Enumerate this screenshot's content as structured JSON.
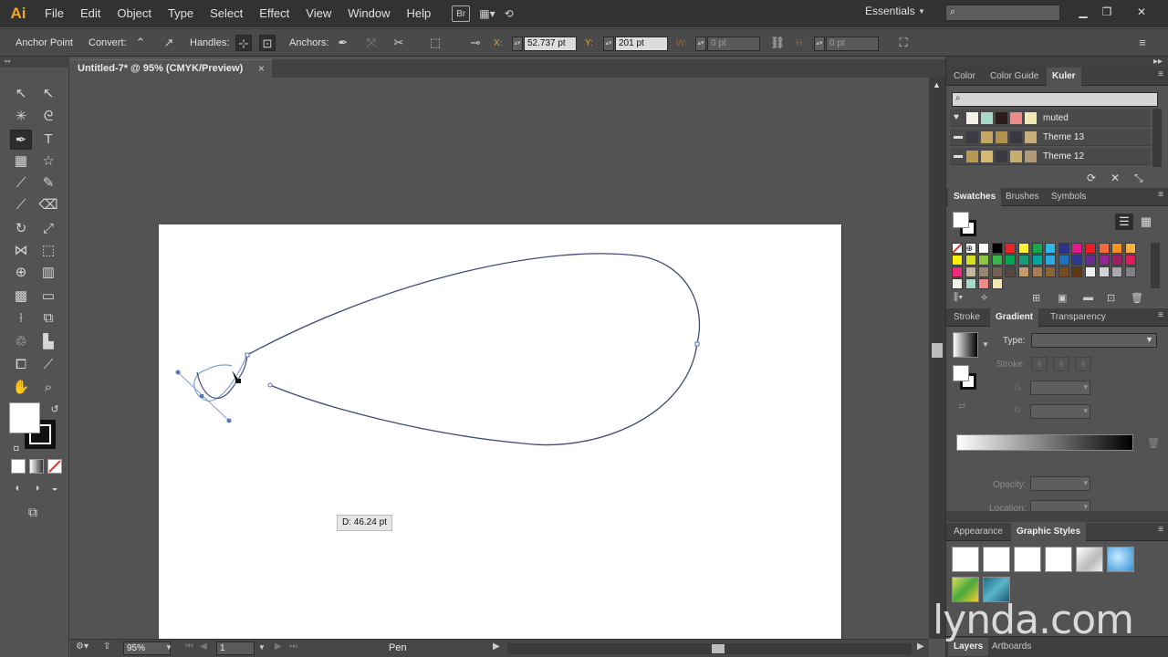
{
  "app": {
    "logo": "Ai"
  },
  "menu": [
    "File",
    "Edit",
    "Object",
    "Type",
    "Select",
    "Effect",
    "View",
    "Window",
    "Help"
  ],
  "menubar": {
    "bridge_label": "Br",
    "workspace": "Essentials",
    "search_placeholder": ""
  },
  "control": {
    "label": "Anchor Point",
    "convert_label": "Convert:",
    "handles_label": "Handles:",
    "anchors_label": "Anchors:",
    "x_label": "X:",
    "x_value": "52.737 pt",
    "y_label": "Y:",
    "y_value": "201 pt",
    "w_label": "W:",
    "w_value": "0 pt",
    "h_label": "H:",
    "h_value": "0 pt"
  },
  "document": {
    "tab_title": "Untitled-7* @ 95% (CMYK/Preview)",
    "close": "×"
  },
  "canvas": {
    "tooltip": "D: 46.24 pt"
  },
  "status": {
    "zoom": "95%",
    "artboard": "1",
    "tool": "Pen"
  },
  "panels": {
    "color_tabs": [
      "Color",
      "Color Guide",
      "Kuler"
    ],
    "kuler_themes": [
      {
        "name": "muted",
        "icon": "heart-icon",
        "colors": [
          "#f4f2e6",
          "#a8d8c8",
          "#2b1a1a",
          "#ee8a8a",
          "#f2e8b2"
        ]
      },
      {
        "name": "Theme 13",
        "icon": "folder-icon",
        "colors": [
          "#3d3a45",
          "#c6a866",
          "#b19050",
          "#3a3642",
          "#c7ad7a"
        ]
      },
      {
        "name": "Theme 12",
        "icon": "folder-icon",
        "colors": [
          "#b89852",
          "#d8b870",
          "#3a3842",
          "#c7ae6c",
          "#b09a76"
        ]
      }
    ],
    "swatches_tabs": [
      "Swatches",
      "Brushes",
      "Symbols"
    ],
    "gradient_tabs": [
      "Stroke",
      "Gradient",
      "Transparency"
    ],
    "gradient": {
      "type_label": "Type:",
      "stroke_label": "Stroke:",
      "opacity_label": "Opacity:",
      "location_label": "Location:"
    },
    "styles_tabs": [
      "Appearance",
      "Graphic Styles"
    ],
    "layers_tabs": [
      "Layers",
      "Artboards"
    ]
  },
  "watermark": "lynda.com"
}
